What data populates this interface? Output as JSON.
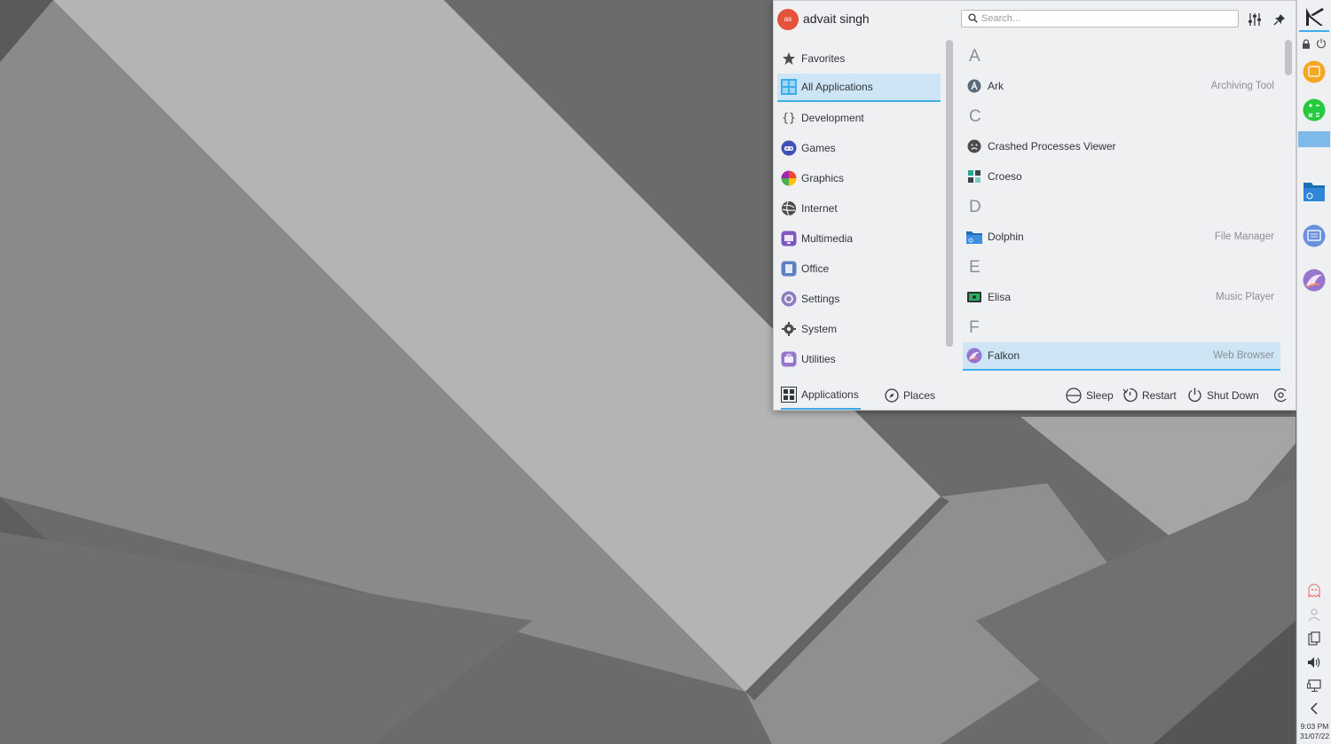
{
  "user": {
    "name": "advait singh",
    "avatar_initials": "as",
    "avatar_color": "#e5533b"
  },
  "search": {
    "placeholder": "Search..."
  },
  "categories": [
    {
      "label": "Favorites",
      "icon": "star-icon"
    },
    {
      "label": "All Applications",
      "icon": "grid-icon",
      "selected": true
    },
    {
      "label": "Development",
      "icon": "braces-icon"
    },
    {
      "label": "Games",
      "icon": "gamepad-icon"
    },
    {
      "label": "Graphics",
      "icon": "color-wheel-icon"
    },
    {
      "label": "Internet",
      "icon": "globe-icon"
    },
    {
      "label": "Multimedia",
      "icon": "multimedia-icon"
    },
    {
      "label": "Office",
      "icon": "office-icon"
    },
    {
      "label": "Settings",
      "icon": "settings-icon"
    },
    {
      "label": "System",
      "icon": "gear-icon"
    },
    {
      "label": "Utilities",
      "icon": "utilities-icon"
    }
  ],
  "app_list": {
    "letters": [
      "A",
      "C",
      "D",
      "E",
      "F"
    ],
    "apps": [
      {
        "name": "Ark",
        "description": "Archiving Tool",
        "icon": "ark-icon"
      },
      {
        "name": "Crashed Processes Viewer",
        "description": "",
        "icon": "crash-face-icon"
      },
      {
        "name": "Croeso",
        "description": "",
        "icon": "croeso-icon"
      },
      {
        "name": "Dolphin",
        "description": "File Manager",
        "icon": "folder-icon"
      },
      {
        "name": "Elisa",
        "description": "Music Player",
        "icon": "elisa-icon"
      },
      {
        "name": "Falkon",
        "description": "Web Browser",
        "icon": "falkon-icon",
        "selected": true
      }
    ]
  },
  "footer": {
    "tabs": [
      {
        "label": "Applications",
        "icon": "apps-grid-icon",
        "selected": true
      },
      {
        "label": "Places",
        "icon": "compass-icon"
      }
    ],
    "actions": [
      {
        "label": "Sleep",
        "icon": "sleep-icon"
      },
      {
        "label": "Restart",
        "icon": "restart-icon"
      },
      {
        "label": "Shut Down",
        "icon": "power-icon"
      }
    ]
  },
  "panel": {
    "time": "9:03 PM",
    "date": "31/07/22"
  },
  "colors": {
    "accent": "#3daee9",
    "selection": "#cde5f4",
    "panel_bg": "#eff0f1"
  }
}
